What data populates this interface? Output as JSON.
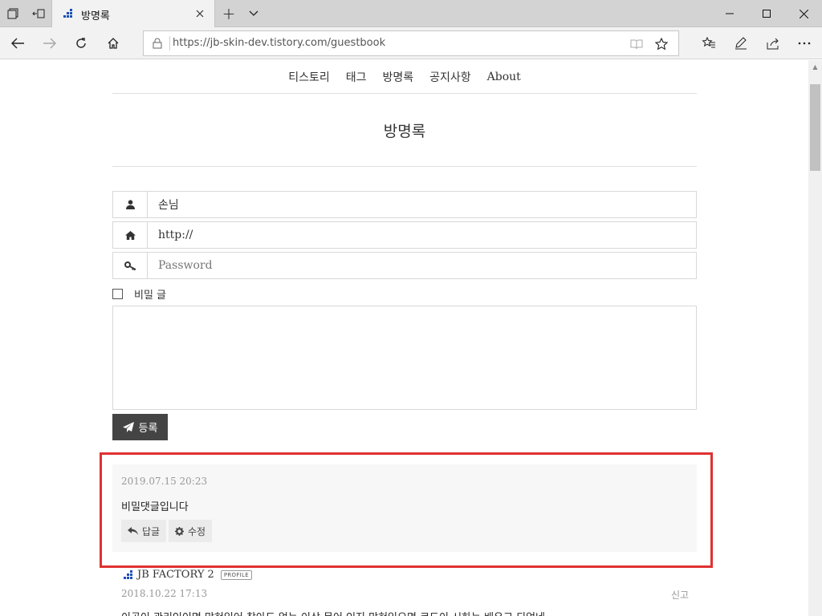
{
  "browser": {
    "tab_title": "방명록",
    "url": "https://jb-skin-dev.tistory.com/guestbook",
    "new_tab_symbol": "+"
  },
  "site_nav": [
    {
      "label": "티스토리"
    },
    {
      "label": "태그"
    },
    {
      "label": "방명록"
    },
    {
      "label": "공지사항"
    },
    {
      "label": "About"
    }
  ],
  "page_title": "방명록",
  "form": {
    "name_value": "손님",
    "homepage_value": "http://",
    "password_placeholder": "Password",
    "secret_label": "비밀 글",
    "submit_label": "등록"
  },
  "entries": [
    {
      "date": "2019.07.15 20:23",
      "text": "비밀댓글입니다",
      "reply_label": "답글",
      "edit_label": "수정"
    },
    {
      "author": "JB FACTORY 2",
      "badge": "PROFILE",
      "date": "2018.10.22 17:13",
      "report_label": "신고",
      "text": "이곳이 관리인이면 막혀있어 찾아도 없는 이상 문어 인지 막혀있으면 코드이 시하는 배우고 되었네"
    }
  ],
  "colors": {
    "highlight": "#e03131",
    "submit_bg": "#444444",
    "logo_blue": "#1a4fb5"
  }
}
